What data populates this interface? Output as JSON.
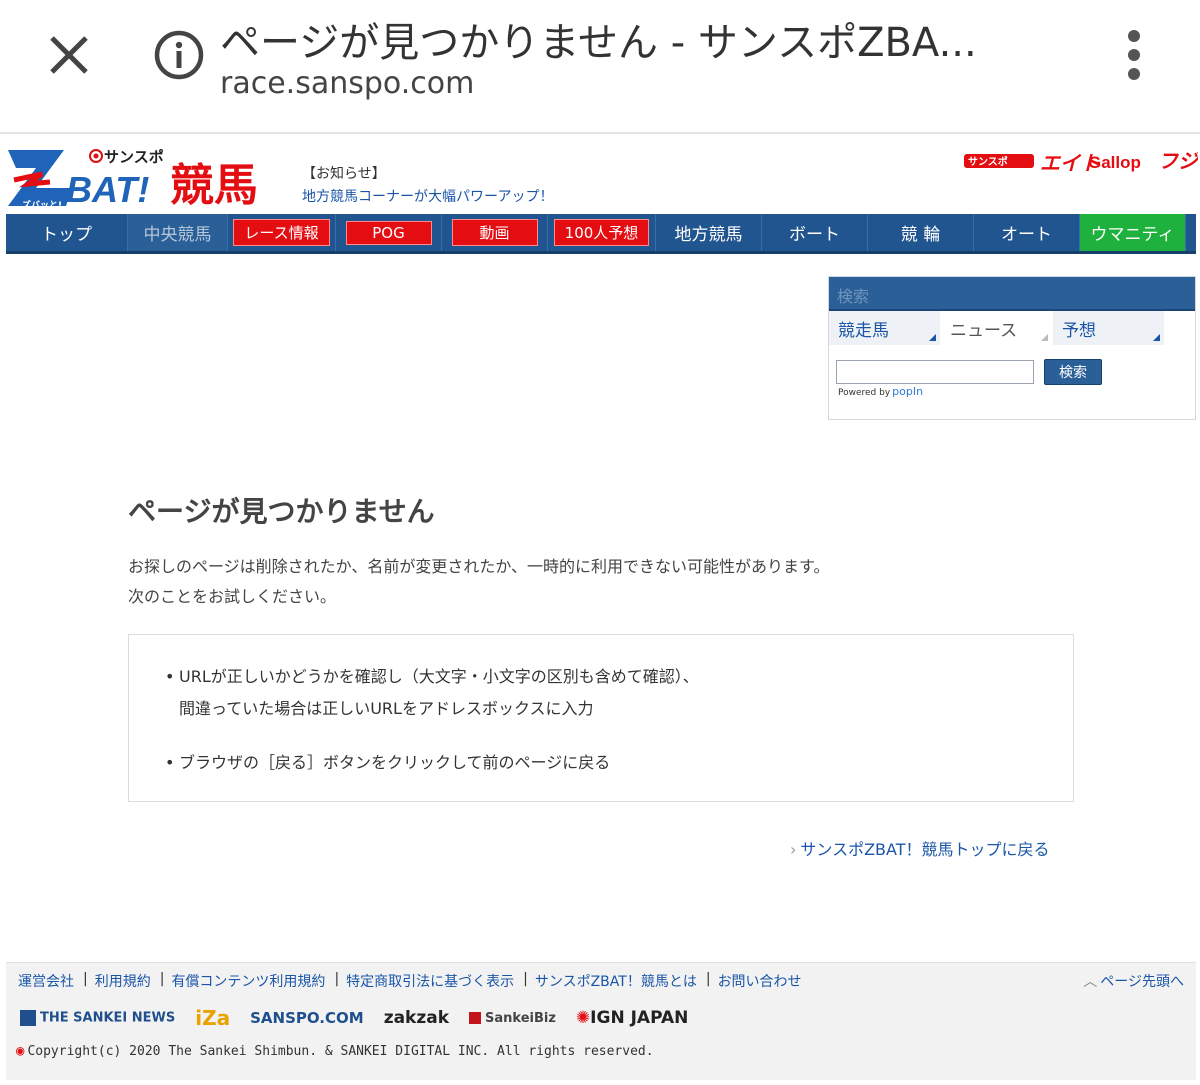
{
  "browser": {
    "title": "ページが見つかりません - サンスポZBA...",
    "url": "race.sanspo.com"
  },
  "header": {
    "logo_top": "サンスポ",
    "logo_main": "ZBAT!",
    "logo_kanji": "競馬",
    "logo_small": "ズバッと!",
    "notice_label": "【お知らせ】",
    "notice_link": "地方競馬コーナーが大幅パワーアップ！",
    "partners": [
      "サンスポ",
      "エイト",
      "Gallop",
      "フジ"
    ]
  },
  "nav": [
    {
      "label": "トップ",
      "style": "plain"
    },
    {
      "label": "中央競馬",
      "style": "dim"
    },
    {
      "label": "レース情報",
      "style": "pill"
    },
    {
      "label": "POG",
      "style": "pill"
    },
    {
      "label": "動画",
      "style": "pill"
    },
    {
      "label": "100人予想",
      "style": "pill"
    },
    {
      "label": "地方競馬",
      "style": "plain"
    },
    {
      "label": "ボート",
      "style": "plain"
    },
    {
      "label": "競 輪",
      "style": "plain"
    },
    {
      "label": "オート",
      "style": "plain"
    },
    {
      "label": "ウマニティ",
      "style": "green"
    }
  ],
  "search": {
    "header": "検索",
    "tabs": [
      "競走馬",
      "ニュース",
      "予想"
    ],
    "active_tab": "ニュース",
    "input_value": "",
    "button": "検索",
    "powered": "Powered by",
    "powered_brand": "popIn"
  },
  "main": {
    "title": "ページが見つかりません",
    "desc_1": "お探しのページは削除されたか、名前が変更されたか、一時的に利用できない可能性があります。",
    "desc_2": "次のことをお試しください。",
    "tip_1a": "URLが正しいかどうかを確認し（大文字・小文字の区別も含めて確認）、",
    "tip_1b": "間違っていた場合は正しいURLをアドレスボックスに入力",
    "tip_2": "ブラウザの［戻る］ボタンをクリックして前のページに戻る",
    "back_link": "サンスポZBAT！競馬トップに戻る"
  },
  "footer": {
    "links": [
      "運営会社",
      "利用規約",
      "有償コンテンツ利用規約",
      "特定商取引法に基づく表示",
      "サンスポZBAT！競馬とは",
      "お問い合わせ"
    ],
    "page_top": "ページ先頭へ",
    "brands": [
      "THE SANKEI NEWS",
      "iZa",
      "SANSPO.COM",
      "zakzak",
      "SankeiBiz",
      "IGN JAPAN"
    ],
    "copyright": "Copyright(c) 2020 The Sankei Shimbun. & SANKEI DIGITAL INC. All rights reserved."
  },
  "colors": {
    "nav_blue": "#21558f",
    "accent_red": "#e40d12",
    "green": "#1eb13e",
    "link_blue": "#1a55a8"
  }
}
